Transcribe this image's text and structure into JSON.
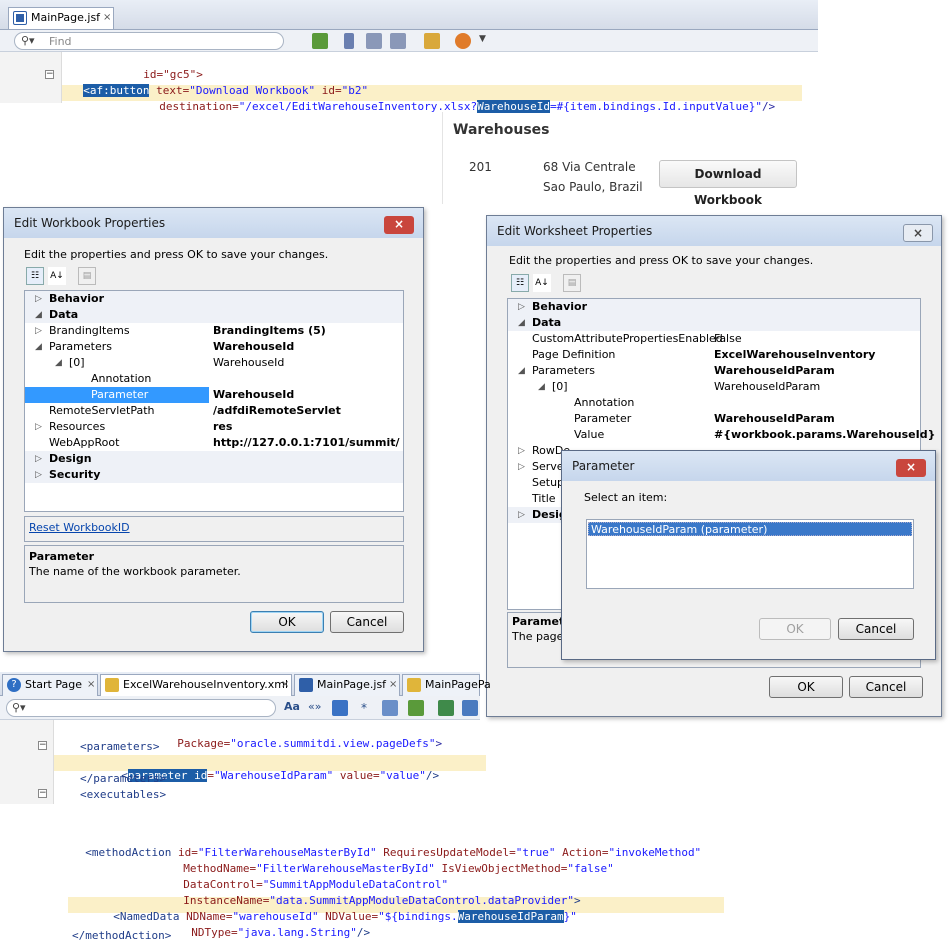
{
  "top_editor": {
    "tab_label": "MainPage.jsf",
    "tab_close": "×",
    "find_placeholder": "Find",
    "code": {
      "line1": "id=\"gc5\">",
      "line2_tag": "<af:button",
      "line2_attr1": " text=",
      "line2_val1": "\"Download Workbook\"",
      "line2_attr2": " id=",
      "line2_val2": "\"b2\"",
      "line3_attr": "destination=",
      "line3_val_a": "\"/excel/EditWarehouseInventory.xlsx?",
      "line3_sel": "WarehouseId",
      "line3_val_b": "=#{item.bindings.Id.inputValue}\"",
      "line3_end": "/>"
    }
  },
  "warehouses": {
    "heading": "Warehouses",
    "id": "201",
    "address_line1": "68 Via Centrale",
    "address_line2": "Sao Paulo, Brazil",
    "button_label": "Download Workbook"
  },
  "workbook_dialog": {
    "title": "Edit Workbook Properties",
    "close": "×",
    "instructions": "Edit the properties and press OK to save your changes.",
    "rows": [
      {
        "type": "cat",
        "tri": "▷",
        "key": "Behavior",
        "value": ""
      },
      {
        "type": "cat",
        "tri": "◢",
        "key": "Data",
        "value": ""
      },
      {
        "type": "prop",
        "tri": "▷",
        "key": "BrandingItems",
        "value": "BrandingItems (5)",
        "bold": true
      },
      {
        "type": "prop",
        "tri": "◢",
        "key": "Parameters",
        "value": "WarehouseId",
        "bold": true
      },
      {
        "type": "prop",
        "tri": "◢",
        "key": "[0]",
        "value": "WarehouseId",
        "bold": false
      },
      {
        "type": "prop",
        "tri": "",
        "key": "Annotation",
        "value": "",
        "bold": false
      },
      {
        "type": "prop",
        "tri": "",
        "key": "Parameter",
        "value": "WarehouseId",
        "bold": true,
        "selected": true
      },
      {
        "type": "prop",
        "tri": "",
        "key": "RemoteServletPath",
        "value": "/adfdiRemoteServlet",
        "bold": true
      },
      {
        "type": "prop",
        "tri": "▷",
        "key": "Resources",
        "value": "res",
        "bold": true
      },
      {
        "type": "prop",
        "tri": "",
        "key": "WebAppRoot",
        "value": "http://127.0.0.1:7101/summit/",
        "bold": true
      },
      {
        "type": "cat",
        "tri": "▷",
        "key": "Design",
        "value": ""
      },
      {
        "type": "cat",
        "tri": "▷",
        "key": "Security",
        "value": ""
      }
    ],
    "reset_link": "Reset WorkbookID",
    "desc_title": "Parameter",
    "desc_text": "The name of the workbook parameter.",
    "ok": "OK",
    "cancel": "Cancel"
  },
  "worksheet_dialog": {
    "title": "Edit Worksheet Properties",
    "close": "×",
    "instructions": "Edit the properties and press OK to save your changes.",
    "rows": [
      {
        "type": "cat",
        "tri": "▷",
        "key": "Behavior",
        "value": ""
      },
      {
        "type": "cat",
        "tri": "◢",
        "key": "Data",
        "value": ""
      },
      {
        "type": "prop",
        "tri": "",
        "key": "CustomAttributePropertiesEnabled",
        "value": "False",
        "bold": false
      },
      {
        "type": "prop",
        "tri": "",
        "key": "Page Definition",
        "value": "ExcelWarehouseInventory",
        "bold": true
      },
      {
        "type": "prop",
        "tri": "◢",
        "key": "Parameters",
        "value": "WarehouseIdParam",
        "bold": true
      },
      {
        "type": "prop",
        "tri": "◢",
        "key": "[0]",
        "value": "WarehouseIdParam",
        "bold": false
      },
      {
        "type": "prop",
        "tri": "",
        "key": "Annotation",
        "value": "",
        "bold": false
      },
      {
        "type": "prop",
        "tri": "",
        "key": "Parameter",
        "value": "WarehouseIdParam",
        "bold": true
      },
      {
        "type": "prop",
        "tri": "",
        "key": "Value",
        "value": "#{workbook.params.WarehouseId}",
        "bold": true
      },
      {
        "type": "prop",
        "tri": "▷",
        "key": "RowDe",
        "value": "",
        "bold": false
      },
      {
        "type": "prop",
        "tri": "▷",
        "key": "Serve",
        "value": "",
        "bold": false
      },
      {
        "type": "prop",
        "tri": "",
        "key": "Setup",
        "value": "",
        "bold": false
      },
      {
        "type": "prop",
        "tri": "",
        "key": "Title",
        "value": "",
        "bold": false
      },
      {
        "type": "cat",
        "tri": "▷",
        "key": "Desig",
        "value": ""
      }
    ],
    "desc_title": "Paramete",
    "desc_text": "The page",
    "ok": "OK",
    "cancel": "Cancel"
  },
  "parameter_dialog": {
    "title": "Parameter",
    "close": "×",
    "prompt": "Select an item:",
    "items": [
      "WarehouseIdParam (parameter)"
    ],
    "ok": "OK",
    "cancel": "Cancel"
  },
  "bottom_editor": {
    "tabs": [
      {
        "label": "Start Page",
        "close": "×"
      },
      {
        "label": "ExcelWarehouseInventory.xml",
        "close": "×"
      },
      {
        "label": "MainPage.jsf",
        "close": "×"
      },
      {
        "label": "MainPagePa",
        "close": ""
      }
    ],
    "code": {
      "l1_attr": "Package=",
      "l1_val": "\"oracle.summitdi.view.pageDefs\"",
      "l1_end": ">",
      "l2": "<parameters>",
      "l3_open": "<",
      "l3_sel": "parameter id",
      "l3_eq": "=",
      "l3_val1": "\"WarehouseIdParam\"",
      "l3_attr2": " value=",
      "l3_val2": "\"value\"",
      "l3_end": "/>",
      "l4": "</parameters>",
      "l5": "<executables>"
    }
  },
  "method_code": {
    "m1_tag": "<methodAction",
    "m1_a1": " id=",
    "m1_v1": "\"FilterWarehouseMasterById\"",
    "m1_a2": " RequiresUpdateModel=",
    "m1_v2": "\"true\"",
    "m1_a3": " Action=",
    "m1_v3": "\"invokeMethod\"",
    "m2_a1": "MethodName=",
    "m2_v1": "\"FilterWarehouseMasterById\"",
    "m2_a2": " IsViewObjectMethod=",
    "m2_v2": "\"false\"",
    "m3_a": "DataControl=",
    "m3_v": "\"SummitAppModuleDataControl\"",
    "m4_a": "InstanceName=",
    "m4_v": "\"data.SummitAppModuleDataControl.dataProvider\"",
    "m4_end": ">",
    "m5_tag": "<NamedData",
    "m5_a1": " NDName=",
    "m5_v1": "\"warehouseId\"",
    "m5_a2": " NDValue=",
    "m5_v2a": "\"${bindings.",
    "m5_sel": "WarehouseIdParam",
    "m5_v2b": "}\"",
    "m6_a": "NDType=",
    "m6_v": "\"java.lang.String\"",
    "m6_end": "/>",
    "m7": "</methodAction>"
  },
  "colors": {
    "selection": "#1c5da7",
    "line_highlight": "#fbf0c8",
    "close_red": "#c9463d"
  }
}
